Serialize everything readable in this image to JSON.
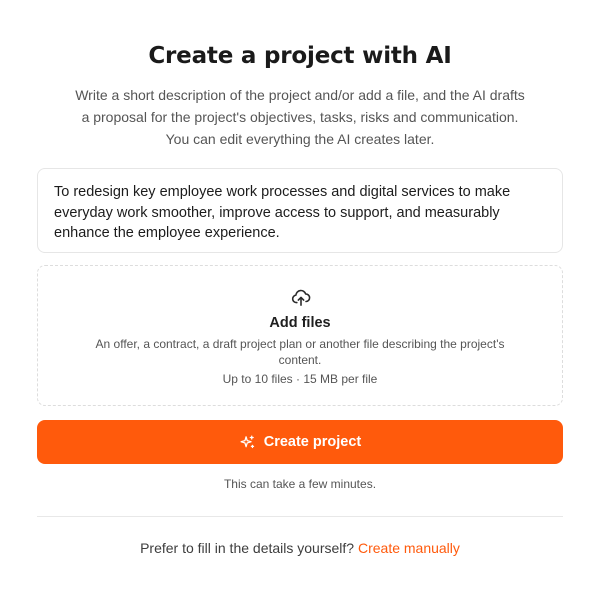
{
  "header": {
    "title": "Create a project with AI",
    "intro": "Write a short description of the project and/or add a file, and the AI drafts a proposal for the project's objectives, tasks, risks and communication. You can edit everything the AI creates later."
  },
  "description": {
    "value": "To redesign key employee work processes and digital services to make everyday work smoother, improve access to support, and measurably enhance the employee experience."
  },
  "upload": {
    "icon": "cloud-upload-icon",
    "title": "Add files",
    "description": "An offer, a contract, a draft project plan or another file describing the project's content.",
    "limits": "Up to 10 files · 15 MB per file"
  },
  "actions": {
    "create_label": "Create project",
    "create_icon": "sparkles-icon",
    "hint": "This can take a few minutes."
  },
  "footer": {
    "prompt": "Prefer to fill in the details yourself?",
    "link_label": "Create manually"
  },
  "colors": {
    "accent": "#ff5a0c",
    "text": "#1f1f1f",
    "muted": "#555555",
    "border": "#e6e6e6"
  }
}
